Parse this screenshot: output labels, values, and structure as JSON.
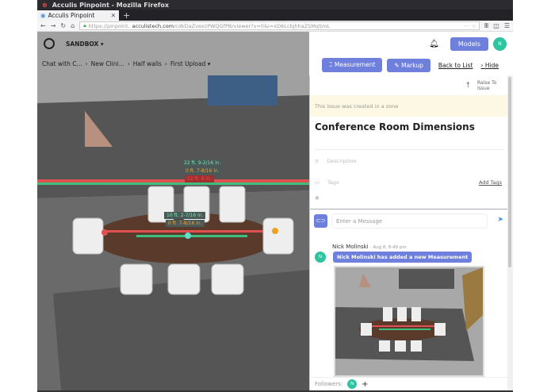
{
  "window": {
    "title": "Acculis Pinpoint - Mozilla Firefox",
    "tab": "Acculis Pinpoint",
    "url_prefix": "https://pinpoint.",
    "url_domain": "acculistech.com",
    "url_path": "/cdkDaZvexzPWQGfPB/viewer?v=0&i=xD6LcbjhhaZSMqSmL"
  },
  "header": {
    "workspace": "SANDBOX ▾",
    "models": "Models",
    "avatar": "N"
  },
  "breadcrumb": [
    "Chat with C...",
    "New Clini...",
    "Half walls",
    "First Upload ▾"
  ],
  "toolbar": {
    "measurement": "Measurement",
    "markup": "Markup",
    "back": "Back to List",
    "hide": "Hide"
  },
  "measurements": [
    "22 ft. 9-2/16 in.",
    "0 ft. 7-8/16 in.",
    "22 ft. 8 in.",
    "10 ft. 2-7/16 in.",
    "0 ft. 7-8/16 in."
  ],
  "issue": {
    "raise": "Raise To Issue",
    "zone_notice": "This issue was created in a zone",
    "title": "Conference Room Dimensions",
    "description_placeholder": "Description",
    "tags_placeholder": "Tags",
    "add_tags": "Add Tags"
  },
  "chat": {
    "placeholder": "Enter a Message",
    "author": "Nick Molinski",
    "time": "· Aug 8, 8:49 pm",
    "avatar": "N",
    "message": "Nick Molinski has added a new Measurement"
  },
  "followers": {
    "label": "Followers:",
    "avatar": "N"
  }
}
